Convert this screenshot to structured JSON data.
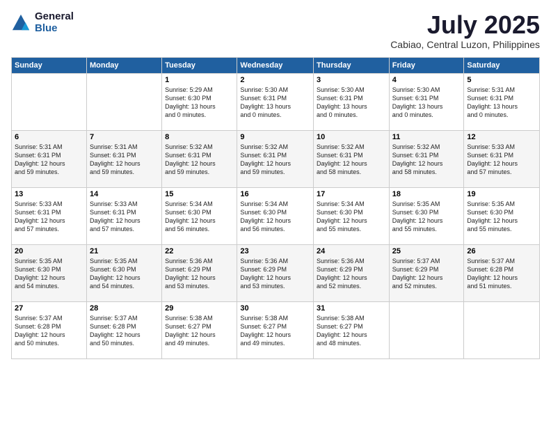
{
  "logo": {
    "general": "General",
    "blue": "Blue"
  },
  "header": {
    "title": "July 2025",
    "location": "Cabiao, Central Luzon, Philippines"
  },
  "weekdays": [
    "Sunday",
    "Monday",
    "Tuesday",
    "Wednesday",
    "Thursday",
    "Friday",
    "Saturday"
  ],
  "weeks": [
    [
      {
        "day": "",
        "info": ""
      },
      {
        "day": "",
        "info": ""
      },
      {
        "day": "1",
        "info": "Sunrise: 5:29 AM\nSunset: 6:30 PM\nDaylight: 13 hours\nand 0 minutes."
      },
      {
        "day": "2",
        "info": "Sunrise: 5:30 AM\nSunset: 6:31 PM\nDaylight: 13 hours\nand 0 minutes."
      },
      {
        "day": "3",
        "info": "Sunrise: 5:30 AM\nSunset: 6:31 PM\nDaylight: 13 hours\nand 0 minutes."
      },
      {
        "day": "4",
        "info": "Sunrise: 5:30 AM\nSunset: 6:31 PM\nDaylight: 13 hours\nand 0 minutes."
      },
      {
        "day": "5",
        "info": "Sunrise: 5:31 AM\nSunset: 6:31 PM\nDaylight: 13 hours\nand 0 minutes."
      }
    ],
    [
      {
        "day": "6",
        "info": "Sunrise: 5:31 AM\nSunset: 6:31 PM\nDaylight: 12 hours\nand 59 minutes."
      },
      {
        "day": "7",
        "info": "Sunrise: 5:31 AM\nSunset: 6:31 PM\nDaylight: 12 hours\nand 59 minutes."
      },
      {
        "day": "8",
        "info": "Sunrise: 5:32 AM\nSunset: 6:31 PM\nDaylight: 12 hours\nand 59 minutes."
      },
      {
        "day": "9",
        "info": "Sunrise: 5:32 AM\nSunset: 6:31 PM\nDaylight: 12 hours\nand 59 minutes."
      },
      {
        "day": "10",
        "info": "Sunrise: 5:32 AM\nSunset: 6:31 PM\nDaylight: 12 hours\nand 58 minutes."
      },
      {
        "day": "11",
        "info": "Sunrise: 5:32 AM\nSunset: 6:31 PM\nDaylight: 12 hours\nand 58 minutes."
      },
      {
        "day": "12",
        "info": "Sunrise: 5:33 AM\nSunset: 6:31 PM\nDaylight: 12 hours\nand 57 minutes."
      }
    ],
    [
      {
        "day": "13",
        "info": "Sunrise: 5:33 AM\nSunset: 6:31 PM\nDaylight: 12 hours\nand 57 minutes."
      },
      {
        "day": "14",
        "info": "Sunrise: 5:33 AM\nSunset: 6:31 PM\nDaylight: 12 hours\nand 57 minutes."
      },
      {
        "day": "15",
        "info": "Sunrise: 5:34 AM\nSunset: 6:30 PM\nDaylight: 12 hours\nand 56 minutes."
      },
      {
        "day": "16",
        "info": "Sunrise: 5:34 AM\nSunset: 6:30 PM\nDaylight: 12 hours\nand 56 minutes."
      },
      {
        "day": "17",
        "info": "Sunrise: 5:34 AM\nSunset: 6:30 PM\nDaylight: 12 hours\nand 55 minutes."
      },
      {
        "day": "18",
        "info": "Sunrise: 5:35 AM\nSunset: 6:30 PM\nDaylight: 12 hours\nand 55 minutes."
      },
      {
        "day": "19",
        "info": "Sunrise: 5:35 AM\nSunset: 6:30 PM\nDaylight: 12 hours\nand 55 minutes."
      }
    ],
    [
      {
        "day": "20",
        "info": "Sunrise: 5:35 AM\nSunset: 6:30 PM\nDaylight: 12 hours\nand 54 minutes."
      },
      {
        "day": "21",
        "info": "Sunrise: 5:35 AM\nSunset: 6:30 PM\nDaylight: 12 hours\nand 54 minutes."
      },
      {
        "day": "22",
        "info": "Sunrise: 5:36 AM\nSunset: 6:29 PM\nDaylight: 12 hours\nand 53 minutes."
      },
      {
        "day": "23",
        "info": "Sunrise: 5:36 AM\nSunset: 6:29 PM\nDaylight: 12 hours\nand 53 minutes."
      },
      {
        "day": "24",
        "info": "Sunrise: 5:36 AM\nSunset: 6:29 PM\nDaylight: 12 hours\nand 52 minutes."
      },
      {
        "day": "25",
        "info": "Sunrise: 5:37 AM\nSunset: 6:29 PM\nDaylight: 12 hours\nand 52 minutes."
      },
      {
        "day": "26",
        "info": "Sunrise: 5:37 AM\nSunset: 6:28 PM\nDaylight: 12 hours\nand 51 minutes."
      }
    ],
    [
      {
        "day": "27",
        "info": "Sunrise: 5:37 AM\nSunset: 6:28 PM\nDaylight: 12 hours\nand 50 minutes."
      },
      {
        "day": "28",
        "info": "Sunrise: 5:37 AM\nSunset: 6:28 PM\nDaylight: 12 hours\nand 50 minutes."
      },
      {
        "day": "29",
        "info": "Sunrise: 5:38 AM\nSunset: 6:27 PM\nDaylight: 12 hours\nand 49 minutes."
      },
      {
        "day": "30",
        "info": "Sunrise: 5:38 AM\nSunset: 6:27 PM\nDaylight: 12 hours\nand 49 minutes."
      },
      {
        "day": "31",
        "info": "Sunrise: 5:38 AM\nSunset: 6:27 PM\nDaylight: 12 hours\nand 48 minutes."
      },
      {
        "day": "",
        "info": ""
      },
      {
        "day": "",
        "info": ""
      }
    ]
  ]
}
